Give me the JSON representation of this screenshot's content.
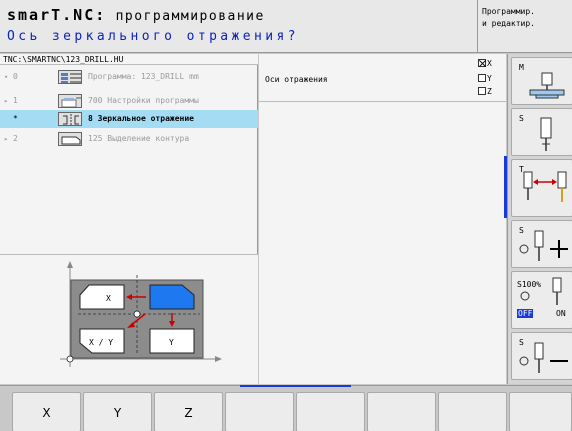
{
  "header": {
    "title_brand": "smarT.NC:",
    "title_mode": "программирование",
    "subtitle": "Ось зеркального отражения?",
    "mode_line1": "Программир.",
    "mode_line2": "и редактир."
  },
  "tree": {
    "path": "TNC:\\SMARTNC\\123_DRILL.HU",
    "rows": [
      {
        "arrow": "▾",
        "num": "0",
        "icon": "program-icon",
        "label": "Программа: 123_DRILL mm"
      },
      {
        "arrow": "▸",
        "num": "1",
        "icon": "settings-icon",
        "label": "700 Настройки программы"
      },
      {
        "arrow": "",
        "num": "*",
        "icon": "mirror-icon",
        "label": "8 Зеркальное отражение"
      },
      {
        "arrow": "▸",
        "num": "2",
        "icon": "contour-icon",
        "label": "125 Выделение контура"
      }
    ]
  },
  "diagram": {
    "x_label": "X",
    "y_label": "Y",
    "xy_label": "X / Y"
  },
  "form": {
    "label": "Оси отражения",
    "axes": [
      {
        "name": "X",
        "checked": true
      },
      {
        "name": "Y",
        "checked": false
      },
      {
        "name": "Z",
        "checked": false
      }
    ]
  },
  "right_keys": {
    "m_label": "M",
    "s_label": "S",
    "t_label": "T",
    "s_plus_label": "S",
    "feed_label": "S100%",
    "off_label": "OFF",
    "on_label": "ON",
    "s_minus_label": "S"
  },
  "bottom_keys": [
    "X",
    "Y",
    "Z",
    "",
    "",
    "",
    "",
    ""
  ],
  "colors": {
    "accent": "#1a3ad8",
    "selected_row": "#a4dcf4",
    "subtitle": "#0d24b8"
  }
}
